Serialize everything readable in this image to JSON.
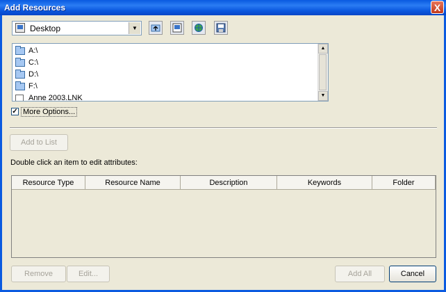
{
  "window": {
    "title": "Add Resources",
    "close_glyph": "X"
  },
  "location": {
    "selected": "Desktop",
    "icon": "desktop-icon"
  },
  "toolbar": {
    "buttons": [
      {
        "name": "up-one-level-icon"
      },
      {
        "name": "desktop-icon"
      },
      {
        "name": "web-icon"
      },
      {
        "name": "save-icon"
      }
    ]
  },
  "files": [
    {
      "label": "A:\\",
      "icon": "folder-icon"
    },
    {
      "label": "C:\\",
      "icon": "folder-icon"
    },
    {
      "label": "D:\\",
      "icon": "folder-icon"
    },
    {
      "label": "F:\\",
      "icon": "folder-icon"
    },
    {
      "label": "Anne 2003.LNK",
      "icon": "shortcut-icon"
    }
  ],
  "more_options": {
    "label": "More Options...",
    "checked": true,
    "check_glyph": "✓"
  },
  "add_to_list": {
    "label": "Add to List"
  },
  "instructions": "Double click an item to edit attributes:",
  "table": {
    "columns": [
      "Resource Type",
      "Resource Name",
      "Description",
      "Keywords",
      "Folder"
    ]
  },
  "buttons": {
    "remove": "Remove",
    "edit": "Edit...",
    "add_all": "Add All",
    "cancel": "Cancel"
  }
}
